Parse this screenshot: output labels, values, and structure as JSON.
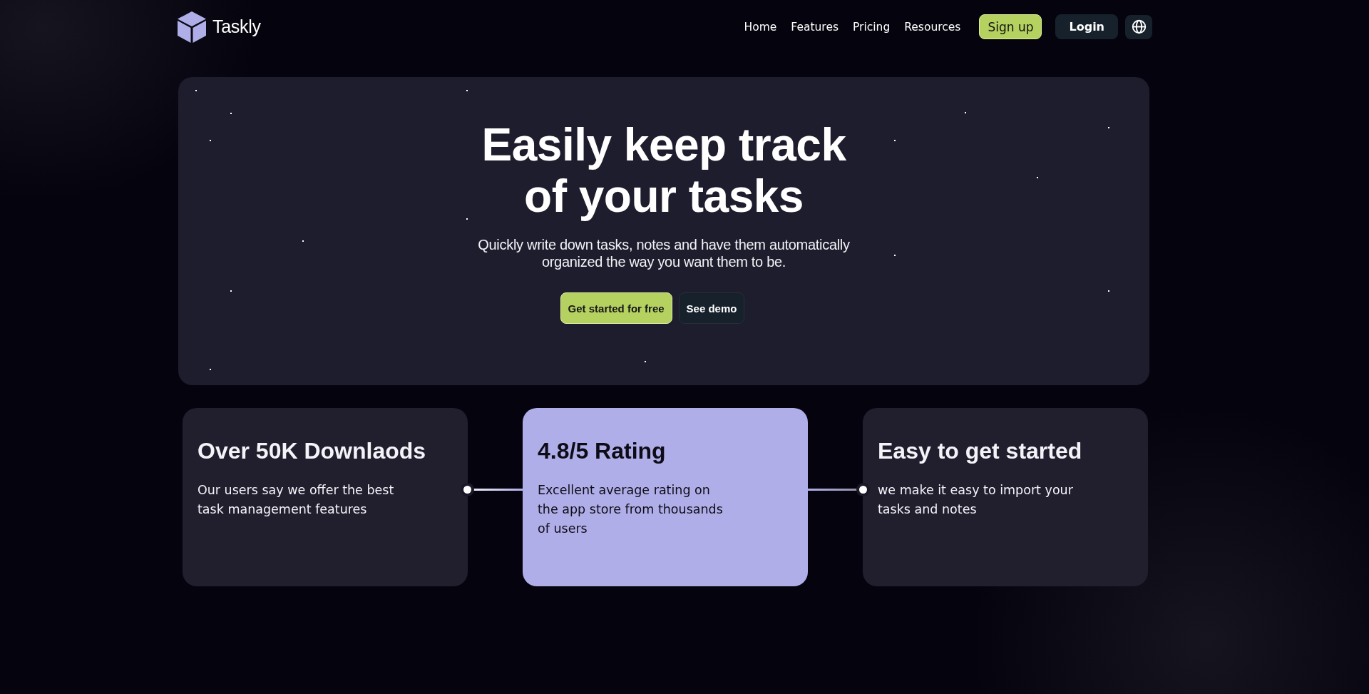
{
  "header": {
    "brand": "Taskly",
    "nav": [
      {
        "label": "Home"
      },
      {
        "label": "Features"
      },
      {
        "label": "Pricing"
      },
      {
        "label": "Resources"
      }
    ],
    "actions": [
      {
        "label": "Sign up",
        "kind": "primary"
      },
      {
        "label": "Login",
        "kind": "secondary"
      }
    ]
  },
  "hero": {
    "title": "Easily keep track of your tasks",
    "subtitle": "Quickly write down tasks, notes and have them automatically organized the way you want them to be.",
    "buttons": [
      {
        "label": "Get started for free",
        "kind": "primary"
      },
      {
        "label": "See demo",
        "kind": "secondary"
      }
    ]
  },
  "features": [
    {
      "title": "Over 50K Downlaods",
      "text": "Our users say we offer the best\ntask management features",
      "highlighted": false
    },
    {
      "title": "4.8/5 Rating",
      "text": "Excellent average rating on\nthe app store from thousands\nof users",
      "highlighted": true
    },
    {
      "title": "Easy to get started",
      "text": "we make it easy to import your\ntasks and notes",
      "highlighted": false
    }
  ]
}
